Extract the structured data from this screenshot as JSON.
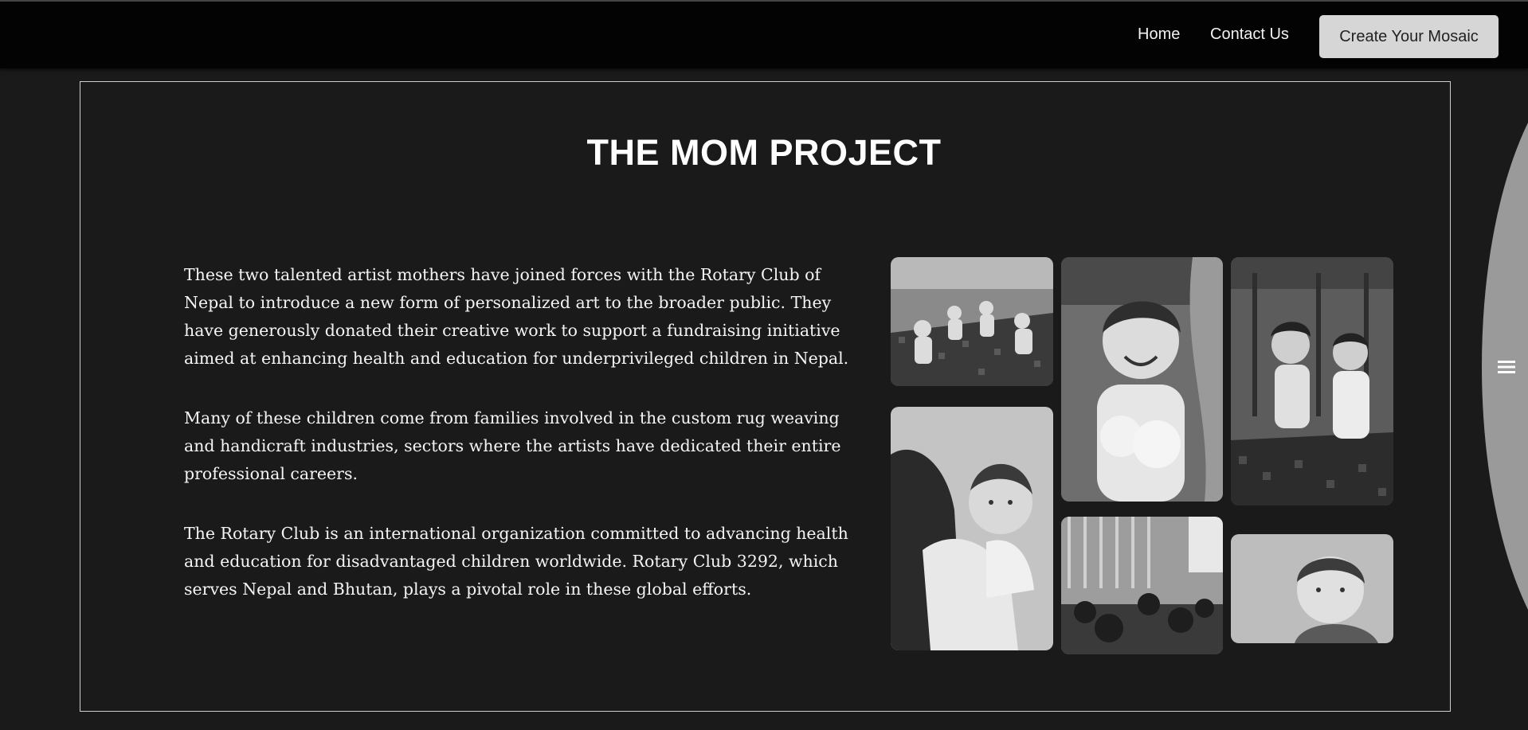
{
  "header": {
    "nav": [
      {
        "label": "Home"
      },
      {
        "label": "Contact Us"
      }
    ],
    "cta_label": "Create Your Mosaic"
  },
  "main": {
    "title": "THE MOM PROJECT",
    "paragraphs": [
      "These two talented artist mothers have joined forces with the Rotary Club of Nepal to introduce a new form of personalized art to the broader public. They have generously donated their creative work to support a fundraising initiative aimed at enhancing health and education for underprivileged children in Nepal.",
      "Many of these children come from families involved in the custom rug weaving and handicraft industries, sectors where the artists have dedicated their entire professional careers.",
      "The Rotary Club is an international organization committed to advancing health and education for disadvantaged children worldwide. Rotary Club 3292, which serves Nepal and Bhutan, plays a pivotal role in these global efforts."
    ]
  },
  "side_menu": {
    "icon": "hamburger-menu-icon"
  },
  "colors": {
    "page_bg": "#1a1a1a",
    "header_bg": "#030303",
    "button_bg": "#d6d6d6",
    "frame_border": "#cfcfcf"
  }
}
